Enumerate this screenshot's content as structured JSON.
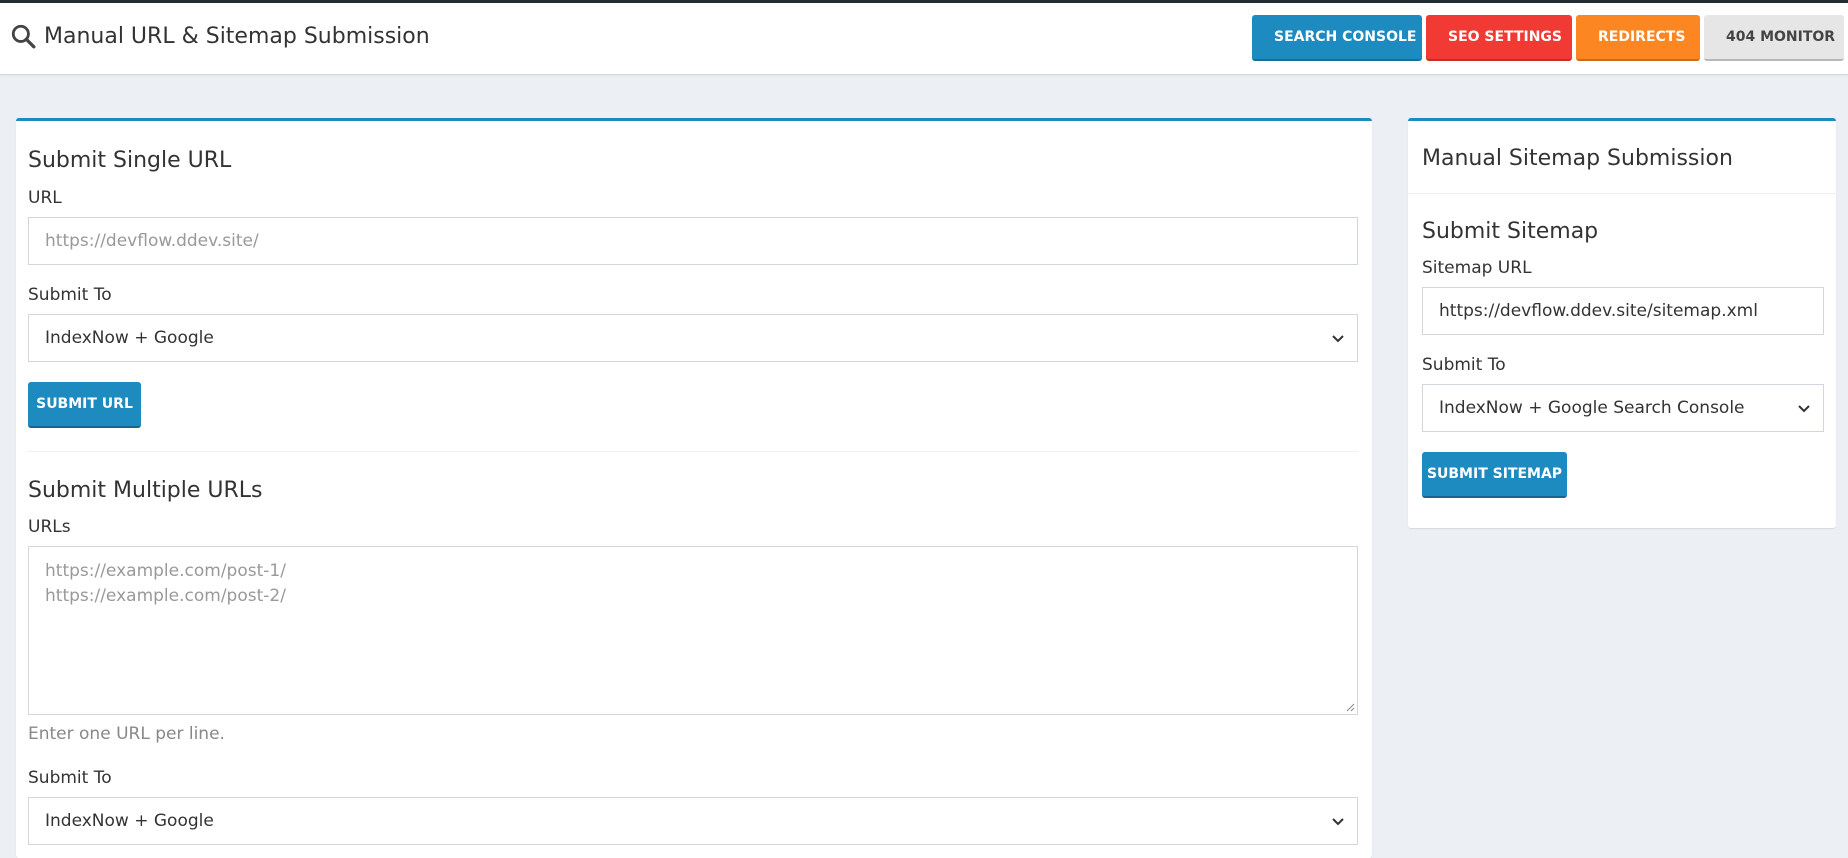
{
  "header": {
    "title": "Manual URL & Sitemap Submission",
    "buttons": {
      "search_console": "SEARCH CONSOLE",
      "seo_settings": "SEO SETTINGS",
      "redirects": "REDIRECTS",
      "monitor_404": "404 MONITOR"
    }
  },
  "single_url": {
    "title": "Submit Single URL",
    "url_label": "URL",
    "url_placeholder": "https://devflow.ddev.site/",
    "submit_to_label": "Submit To",
    "submit_to_value": "IndexNow + Google",
    "button": "SUBMIT URL"
  },
  "multiple_urls": {
    "title": "Submit Multiple URLs",
    "urls_label": "URLs",
    "placeholder_lines": [
      "https://example.com/post-1/",
      "https://example.com/post-2/"
    ],
    "help_text": "Enter one URL per line.",
    "submit_to_label": "Submit To",
    "submit_to_value": "IndexNow + Google"
  },
  "sitemap": {
    "box_title": "Manual Sitemap Submission",
    "title": "Submit Sitemap",
    "url_label": "Sitemap URL",
    "url_value": "https://devflow.ddev.site/sitemap.xml",
    "submit_to_label": "Submit To",
    "submit_to_value": "IndexNow + Google Search Console",
    "button": "SUBMIT SITEMAP"
  },
  "colors": {
    "primary": "#1d8ac0",
    "danger": "#f03a33",
    "warning": "#fb8622",
    "background": "#ecf0f5"
  }
}
